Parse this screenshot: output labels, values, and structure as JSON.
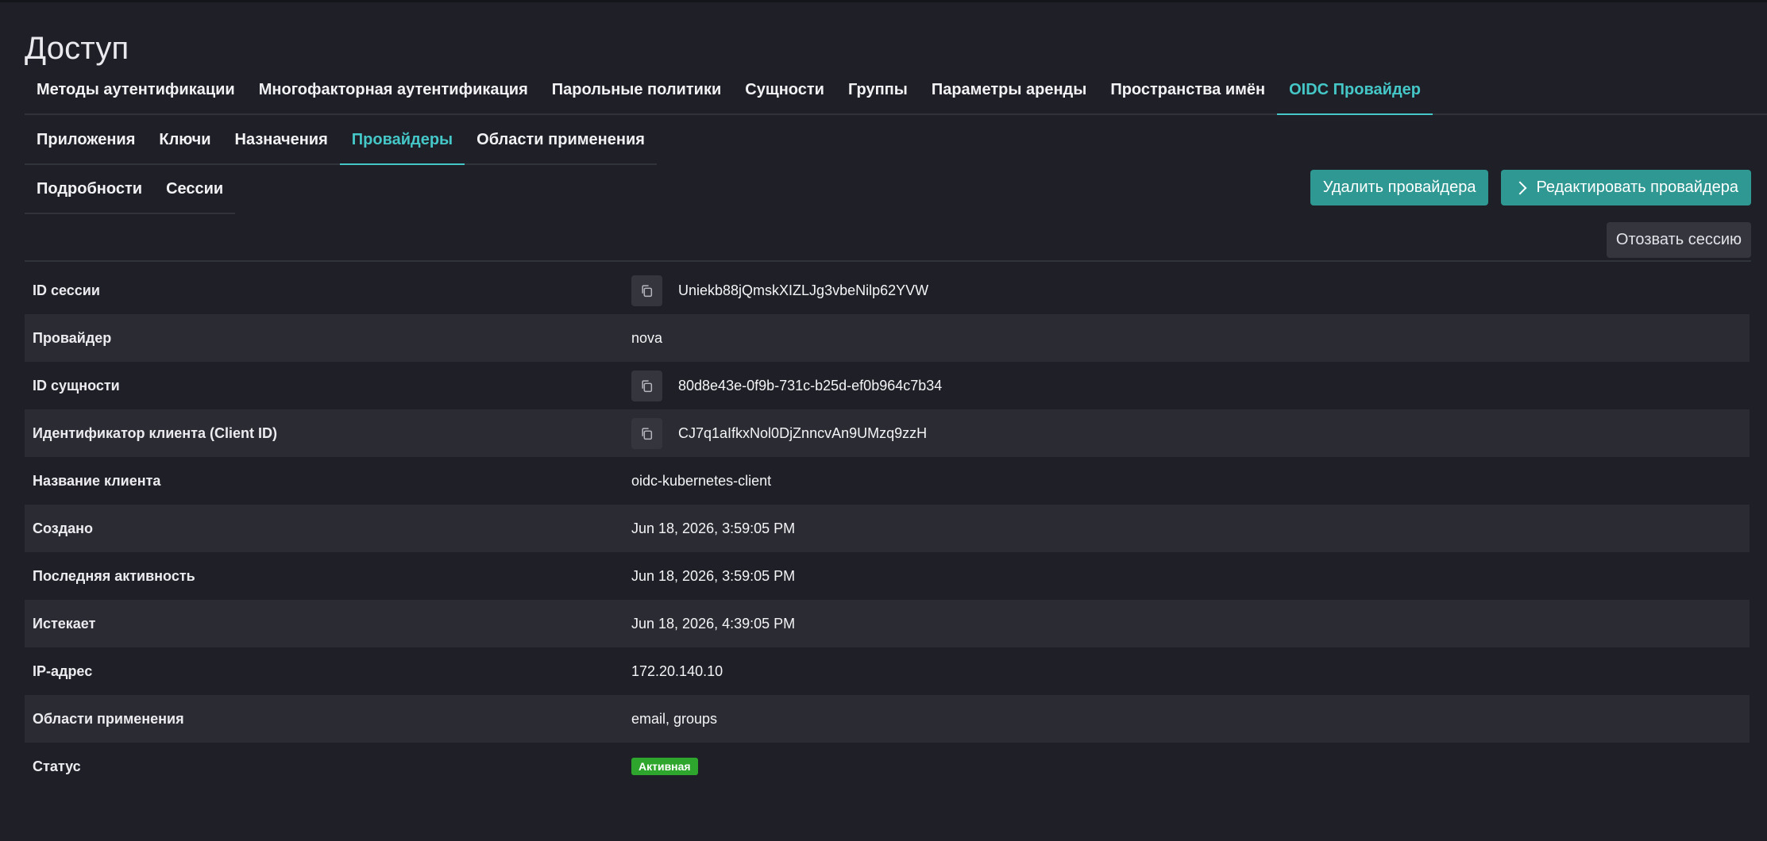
{
  "title": "Доступ",
  "primary_tabs": [
    {
      "label": "Методы аутентификации"
    },
    {
      "label": "Многофакторная аутентификация"
    },
    {
      "label": "Парольные политики"
    },
    {
      "label": "Сущности"
    },
    {
      "label": "Группы"
    },
    {
      "label": "Параметры аренды"
    },
    {
      "label": "Пространства имён"
    },
    {
      "label": "OIDC Провайдер"
    }
  ],
  "secondary_tabs": [
    {
      "label": "Приложения"
    },
    {
      "label": "Ключи"
    },
    {
      "label": "Назначения"
    },
    {
      "label": "Провайдеры"
    },
    {
      "label": "Области применения"
    }
  ],
  "tertiary_tabs": [
    {
      "label": "Подробности"
    },
    {
      "label": "Сессии"
    }
  ],
  "actions": {
    "delete_label": "Удалить провайдера",
    "edit_label": "Редактировать провайдера",
    "revoke_label": "Отозвать сессию"
  },
  "details": [
    {
      "label": "ID сессии",
      "value": "Uniekb88jQmskXIZLJg3vbeNilp62YVW"
    },
    {
      "label": "Провайдер",
      "value": "nova"
    },
    {
      "label": "ID сущности",
      "value": "80d8e43e-0f9b-731c-b25d-ef0b964c7b34"
    },
    {
      "label": "Идентификатор клиента (Client ID)",
      "value": "CJ7q1aIfkxNol0DjZnncvAn9UMzq9zzH"
    },
    {
      "label": "Название клиента",
      "value": "oidc-kubernetes-client"
    },
    {
      "label": "Создано",
      "value": "Jun 18, 2026, 3:59:05 PM"
    },
    {
      "label": "Последняя активность",
      "value": "Jun 18, 2026, 3:59:05 PM"
    },
    {
      "label": "Истекает",
      "value": "Jun 18, 2026, 4:39:05 PM"
    },
    {
      "label": "IP-адрес",
      "value": "172.20.140.10"
    },
    {
      "label": "Области применения",
      "value": "email, groups"
    },
    {
      "label": "Статус",
      "value": "Активная"
    }
  ],
  "colors": {
    "accent": "#45c7c8",
    "primary_button": "#2f9893",
    "status_active": "#2ea62e"
  }
}
